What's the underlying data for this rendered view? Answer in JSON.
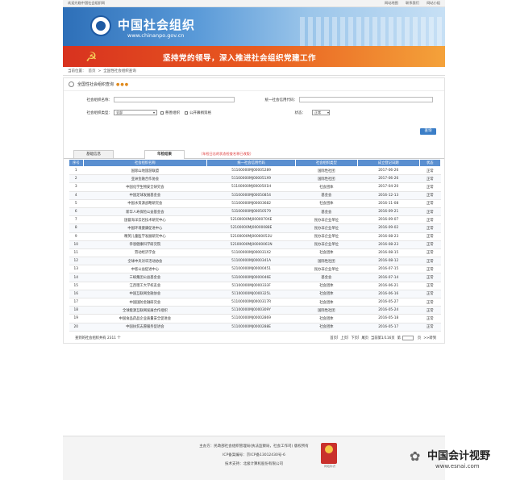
{
  "topbar": {
    "welcome": "欢迎光临中国社会组织网",
    "links": [
      "网站地图",
      "联系我们",
      "网站小组"
    ]
  },
  "banner": {
    "title": "中国社会组织",
    "url": "www.chinanpo.gov.cn",
    "slogan": "坚持党的领导，深入推进社会组织党建工作"
  },
  "breadcrumb": {
    "prefix": "当前位置：",
    "home": "首页",
    "sep": ">",
    "current": "全国性社会组织查询"
  },
  "query_panel": {
    "title": "全国性社会组织查询",
    "name_label": "社会组织名称：",
    "code_label": "统一社会信用代码：",
    "type_label": "社会组织类型：",
    "type_value": "全部",
    "check1": "慈善组织",
    "check2": "公开募捐资格",
    "status_label": "状态：",
    "status_value": "正常",
    "query_button": "查询"
  },
  "tabs": {
    "tab1": "基础信息",
    "tab2": "年检结果",
    "note": "（年检日志的状态检查名称已改版）"
  },
  "table": {
    "headers": [
      "序号",
      "社会组织名称",
      "统一社会信用代码",
      "社会组织类型",
      "成立登记日期",
      "状态"
    ],
    "rows": [
      [
        "1",
        "国际山地旅游联盟",
        "51100000MJ00005289",
        "国际性社团",
        "2017-06-26",
        "正常"
      ],
      [
        "2",
        "亚洲金融合作协会",
        "51100000MJ000051X9",
        "国际性社团",
        "2017-06-26",
        "正常"
      ],
      [
        "3",
        "中国化学生物安全研究会",
        "51100000MJ0000501H",
        "社会团体",
        "2017-04-20",
        "正常"
      ],
      [
        "4",
        "中国足球发展基金会",
        "53100000MJ00050854",
        "基金会",
        "2016-12-13",
        "正常"
      ],
      [
        "5",
        "中国水资源战略研究会",
        "51100000MJ00003682",
        "社会团体",
        "2016-11-08",
        "正常"
      ],
      [
        "6",
        "新华人寿保险公益基金会",
        "53100000MJ00050579",
        "基金会",
        "2016-09-21",
        "正常"
      ],
      [
        "7",
        "国督海洋云岩技术研究中心",
        "52100000MJ0000070XE",
        "民办非企业单位",
        "2016-09-07",
        "正常"
      ],
      [
        "8",
        "中国环境健康促进中心",
        "52100000MJ00000088E",
        "民办非企业单位",
        "2016-09-02",
        "正常"
      ],
      [
        "9",
        "精英儿童医学发展研究中心",
        "52100000MJ00000053U",
        "民办非企业单位",
        "2016-08-23",
        "正常"
      ],
      [
        "10",
        "恭恩健康科学研究院",
        "52100000MJ00000061N",
        "民办非企业单位",
        "2016-08-23",
        "正常"
      ],
      [
        "11",
        "劳动经济学会",
        "51100000MJ000031X2",
        "社会团体",
        "2016-08-15",
        "正常"
      ],
      [
        "12",
        "全球中央对华活动协会",
        "51100000MJ0000341A",
        "国际性社团",
        "2016-08-12",
        "正常"
      ],
      [
        "13",
        "中客公益促进中心",
        "52100000MJ00000451",
        "民办非企业单位",
        "2016-07-15",
        "正常"
      ],
      [
        "14",
        "三峡集团公益基金会",
        "53100000MJ0000046E",
        "基金会",
        "2016-07-14",
        "正常"
      ],
      [
        "15",
        "江西理工大学校友会",
        "51100000MJ0000333F",
        "社会团体",
        "2016-06-21",
        "正常"
      ],
      [
        "16",
        "中国互联网金融协会",
        "51100000MJ0000325L",
        "社会团体",
        "2016-06-16",
        "正常"
      ],
      [
        "17",
        "中国国防金融研究会",
        "51100000MJ0000317R",
        "社会团体",
        "2016-05-27",
        "正常"
      ],
      [
        "18",
        "全球能源互联网发展合作组织",
        "51100000MJ0000309Y",
        "国际性社团",
        "2016-05-24",
        "正常"
      ],
      [
        "19",
        "中国食品药品企业质量安全促进会",
        "51100000MJ00002869",
        "社会团体",
        "2016-05-18",
        "正常"
      ],
      [
        "20",
        "中国扶贫志愿服务促进会",
        "51100000MJ0000288E",
        "社会团体",
        "2016-05-17",
        "正常"
      ]
    ]
  },
  "pagination": {
    "total": "查到的社会组织共有  2311 个",
    "first": "首页",
    "prev": "上页",
    "next": "下页",
    "last": "尾页",
    "current": "当前第1/116页",
    "goto": "第",
    "page_unit": "页",
    "jump": ">>转到"
  },
  "footer": {
    "sponsor": "主办方：民政部社会组织管理局(执法监察局，社会工作司)  版权所有",
    "icp": "ICP备案编号：京ICP备13012430号-6",
    "support": "技术支持：北极计算机股份有限公司",
    "seal_text": "网站标识"
  },
  "watermark": {
    "title": "中国会计视野",
    "url": "www.esnai.com"
  }
}
